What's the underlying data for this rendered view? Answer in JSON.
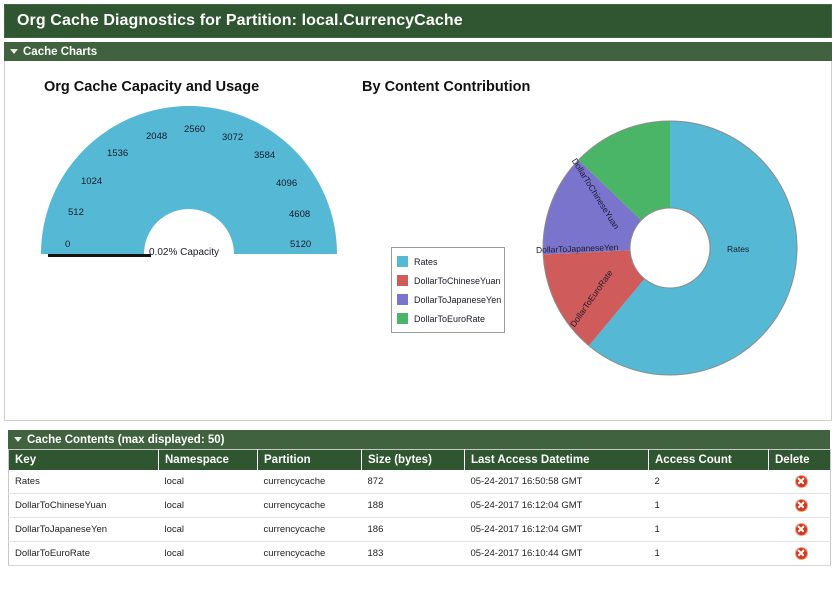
{
  "page": {
    "title": "Org Cache Diagnostics for Partition: local.CurrencyCache"
  },
  "sections": {
    "charts": {
      "label": "Cache Charts"
    },
    "contents": {
      "label": "Cache Contents (max displayed: 50)"
    }
  },
  "colors": {
    "header_green": "#2f5630",
    "section_green": "#41623e",
    "rates": "#55b8d4",
    "chinese_yuan": "#cf5b5b",
    "japanese_yen": "#7b74cc",
    "euro_rate": "#4bb567",
    "delete_red": "#d4361f"
  },
  "charts": {
    "gauge": {
      "title": "Org Cache Capacity and Usage",
      "center_label": "0.02% Capacity"
    },
    "donut": {
      "title": "By Content Contribution"
    },
    "legend": {
      "items": [
        {
          "label": "Rates",
          "color": "#55b8d4"
        },
        {
          "label": "DollarToChineseYuan",
          "color": "#cf5b5b"
        },
        {
          "label": "DollarToJapaneseYen",
          "color": "#7b74cc"
        },
        {
          "label": "DollarToEuroRate",
          "color": "#4bb567"
        }
      ]
    }
  },
  "chart_data": [
    {
      "type": "gauge",
      "title": "Org Cache Capacity and Usage",
      "center_label": "0.02% Capacity",
      "value": 1.024,
      "value_percent": 0.02,
      "min": 0,
      "max": 5120,
      "unit": "KB",
      "tick_labels": [
        "0",
        "512",
        "1024",
        "1536",
        "2048",
        "2560",
        "3072",
        "3584",
        "4096",
        "4608",
        "5120"
      ],
      "tick_values": [
        0,
        512,
        1024,
        1536,
        2048,
        2560,
        3072,
        3584,
        4096,
        4608,
        5120
      ],
      "arc_start_deg": 180,
      "arc_end_deg": 360,
      "fill_color": "#55b8d4",
      "needle_color": "#111111",
      "grid": false,
      "legend": "none"
    },
    {
      "type": "pie",
      "subtype": "donut",
      "title": "By Content Contribution",
      "categories": [
        "Rates",
        "DollarToChineseYuan",
        "DollarToJapaneseYen",
        "DollarToEuroRate"
      ],
      "values": [
        872,
        188,
        186,
        183
      ],
      "value_unit": "bytes",
      "percentages": [
        60.6,
        13.1,
        12.9,
        12.7
      ],
      "colors": [
        "#55b8d4",
        "#cf5b5b",
        "#7b74cc",
        "#4bb567"
      ],
      "inner_radius_ratio": 0.315,
      "legend": "left",
      "xlabel": "",
      "ylabel": ""
    }
  ],
  "table": {
    "columns": [
      "Key",
      "Namespace",
      "Partition",
      "Size (bytes)",
      "Last Access Datetime",
      "Access Count",
      "Delete"
    ],
    "rows": [
      {
        "key": "Rates",
        "namespace": "local",
        "partition": "currencycache",
        "size": "872",
        "last_access": "05-24-2017 16:50:58 GMT",
        "access_count": "2",
        "delete_icon": "delete-circle-x-icon"
      },
      {
        "key": "DollarToChineseYuan",
        "namespace": "local",
        "partition": "currencycache",
        "size": "188",
        "last_access": "05-24-2017 16:12:04 GMT",
        "access_count": "1",
        "delete_icon": "delete-circle-x-icon"
      },
      {
        "key": "DollarToJapaneseYen",
        "namespace": "local",
        "partition": "currencycache",
        "size": "186",
        "last_access": "05-24-2017 16:12:04 GMT",
        "access_count": "1",
        "delete_icon": "delete-circle-x-icon"
      },
      {
        "key": "DollarToEuroRate",
        "namespace": "local",
        "partition": "currencycache",
        "size": "183",
        "last_access": "05-24-2017 16:10:44 GMT",
        "access_count": "1",
        "delete_icon": "delete-circle-x-icon"
      }
    ]
  }
}
